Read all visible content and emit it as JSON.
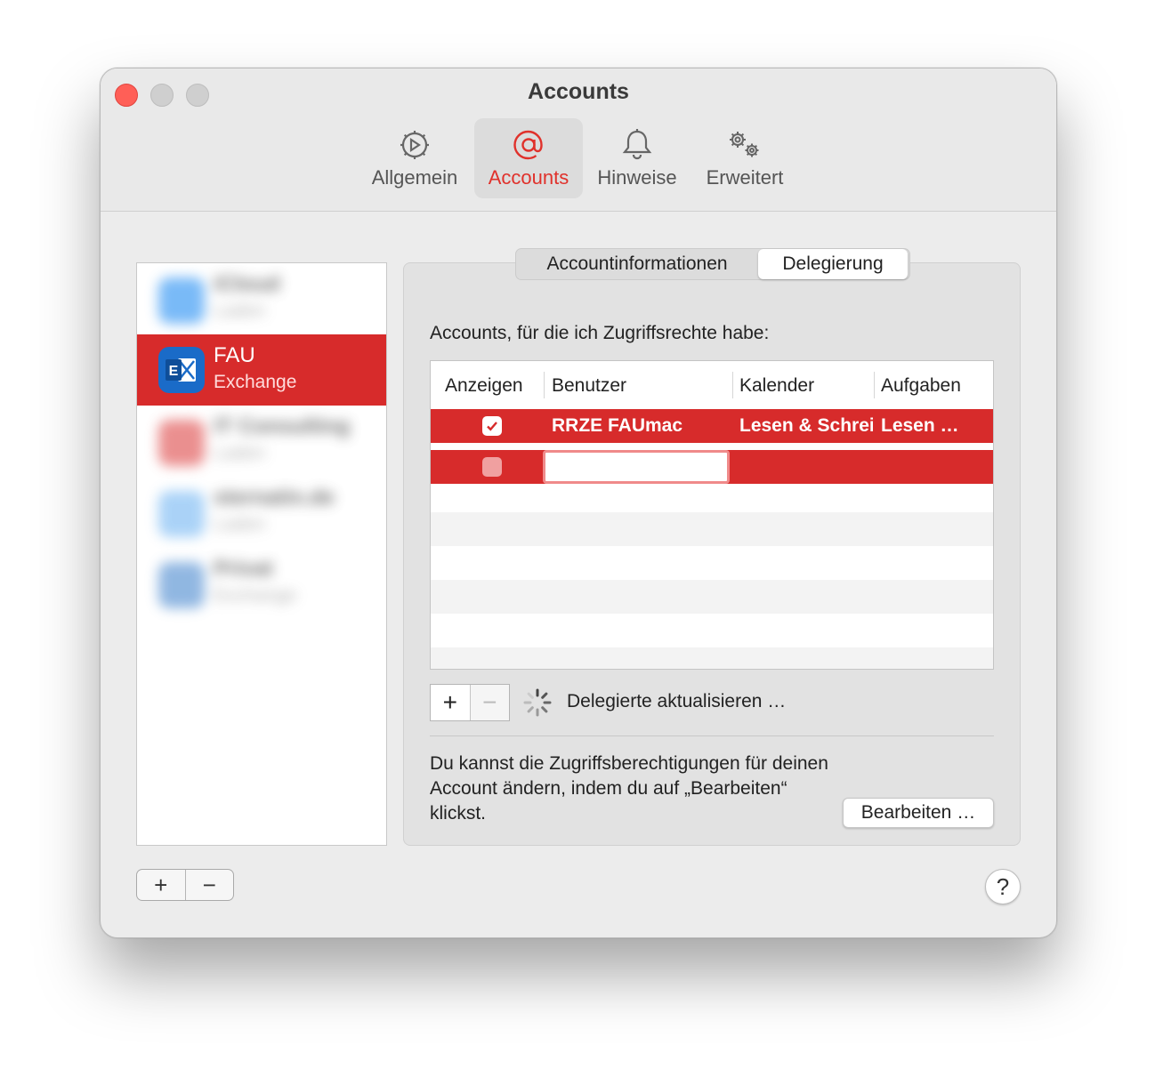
{
  "window": {
    "title": "Accounts"
  },
  "toolbar": {
    "items": [
      {
        "label": "Allgemein",
        "icon": "general-icon"
      },
      {
        "label": "Accounts",
        "icon": "at-sign-icon",
        "active": true
      },
      {
        "label": "Hinweise",
        "icon": "bell-icon"
      },
      {
        "label": "Erweitert",
        "icon": "gears-icon"
      }
    ],
    "active_color": "#e0312b"
  },
  "accounts": {
    "items": [
      {
        "name": "iCloud",
        "type": "Laden",
        "blurred": true
      },
      {
        "name": "FAU",
        "type": "Exchange",
        "selected": true
      },
      {
        "name": "IT Consulting",
        "type": "Laden",
        "blurred": true
      },
      {
        "name": "sternatin.de",
        "type": "Laden",
        "blurred": true
      },
      {
        "name": "Privat",
        "type": "Exchange",
        "blurred": true
      }
    ],
    "add_label": "+",
    "remove_label": "−",
    "selection_color": "#d72b2b"
  },
  "tabs": {
    "info": "Accountinformationen",
    "delegation": "Delegierung",
    "selected": "Delegierung"
  },
  "delegation": {
    "section_label": "Accounts, für die ich Zugriffsrechte habe:",
    "columns": [
      "Anzeigen",
      "Benutzer",
      "Kalender",
      "Aufgaben"
    ],
    "rows": [
      {
        "show": true,
        "user": "RRZE FAUmac",
        "calendar": "Lesen & Schreiben",
        "tasks": "Lesen & Schreiben"
      },
      {
        "show": false,
        "user": "",
        "calendar": "",
        "tasks": "",
        "editing": true
      }
    ],
    "add_label": "+",
    "remove_label": "−",
    "status": "Delegierte aktualisieren …",
    "info": "Du kannst die Zugriffsberechtigungen für deinen Account ändern, indem du auf „Bearbeiten“ klickst.",
    "edit_button": "Bearbeiten …"
  },
  "help": {
    "label": "?"
  }
}
